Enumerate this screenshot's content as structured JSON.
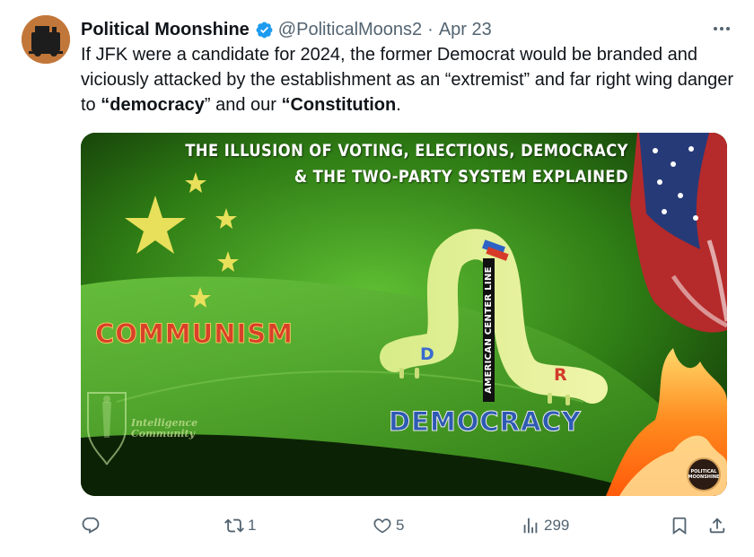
{
  "tweet": {
    "author_name": "Political Moonshine",
    "handle": "@PoliticalMoons2",
    "separator": "·",
    "date": "Apr 23",
    "text_parts": [
      "If JFK were a candidate for 2024, the former Democrat would be branded and viciously attacked by the establishment as an “extremist” and far right wing danger to ",
      "“democracy",
      "” and our ",
      "“Constitution",
      "."
    ]
  },
  "media": {
    "title_line1": "THE ILLUSION OF VOTING, ELECTIONS, DEMOCRACY",
    "title_line2": "& THE TWO-PARTY SYSTEM EXPLAINED",
    "label_communism": "COMMUNISM",
    "label_democracy": "DEMOCRACY",
    "label_center": "AMERICAN CENTER LINE",
    "label_d": "D",
    "label_r": "R",
    "label_intel_line1": "Intelligence",
    "label_intel_line2": "Community",
    "logo_line1": "POLITICAL",
    "logo_line2": "MOONSHINE"
  },
  "actions": {
    "reply_count": "",
    "retweet_count": "1",
    "like_count": "5",
    "views_count": "299"
  },
  "colors": {
    "verified": "#1d9bf0",
    "text_secondary": "#536471",
    "leaf_green": "#3f9a1f",
    "communism_red": "#d9402a",
    "democracy_blue": "#2e5bb2"
  },
  "icons": [
    "more-icon",
    "verified-badge-icon",
    "reply-icon",
    "retweet-icon",
    "like-icon",
    "views-icon",
    "bookmark-icon",
    "share-icon"
  ]
}
